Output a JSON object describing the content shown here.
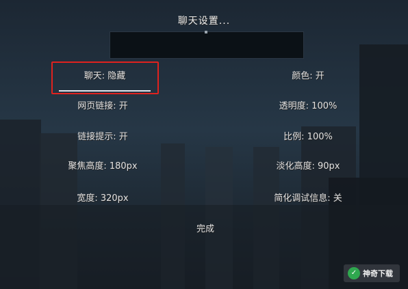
{
  "title": "聊天设置...",
  "options": {
    "chat": "聊天: 隐藏",
    "color": "颜色: 开",
    "web_links": "网页链接: 开",
    "opacity": "透明度: 100%",
    "link_prompt": "链接提示: 开",
    "scale": "比例: 100%",
    "focus_height": "聚焦高度: 180px",
    "fade_height": "淡化高度: 90px",
    "width": "宽度: 320px",
    "reduced_debug": "简化调试信息: 关"
  },
  "done_label": "完成",
  "watermark": {
    "logo_text": "✓",
    "text": "神奇下载"
  }
}
